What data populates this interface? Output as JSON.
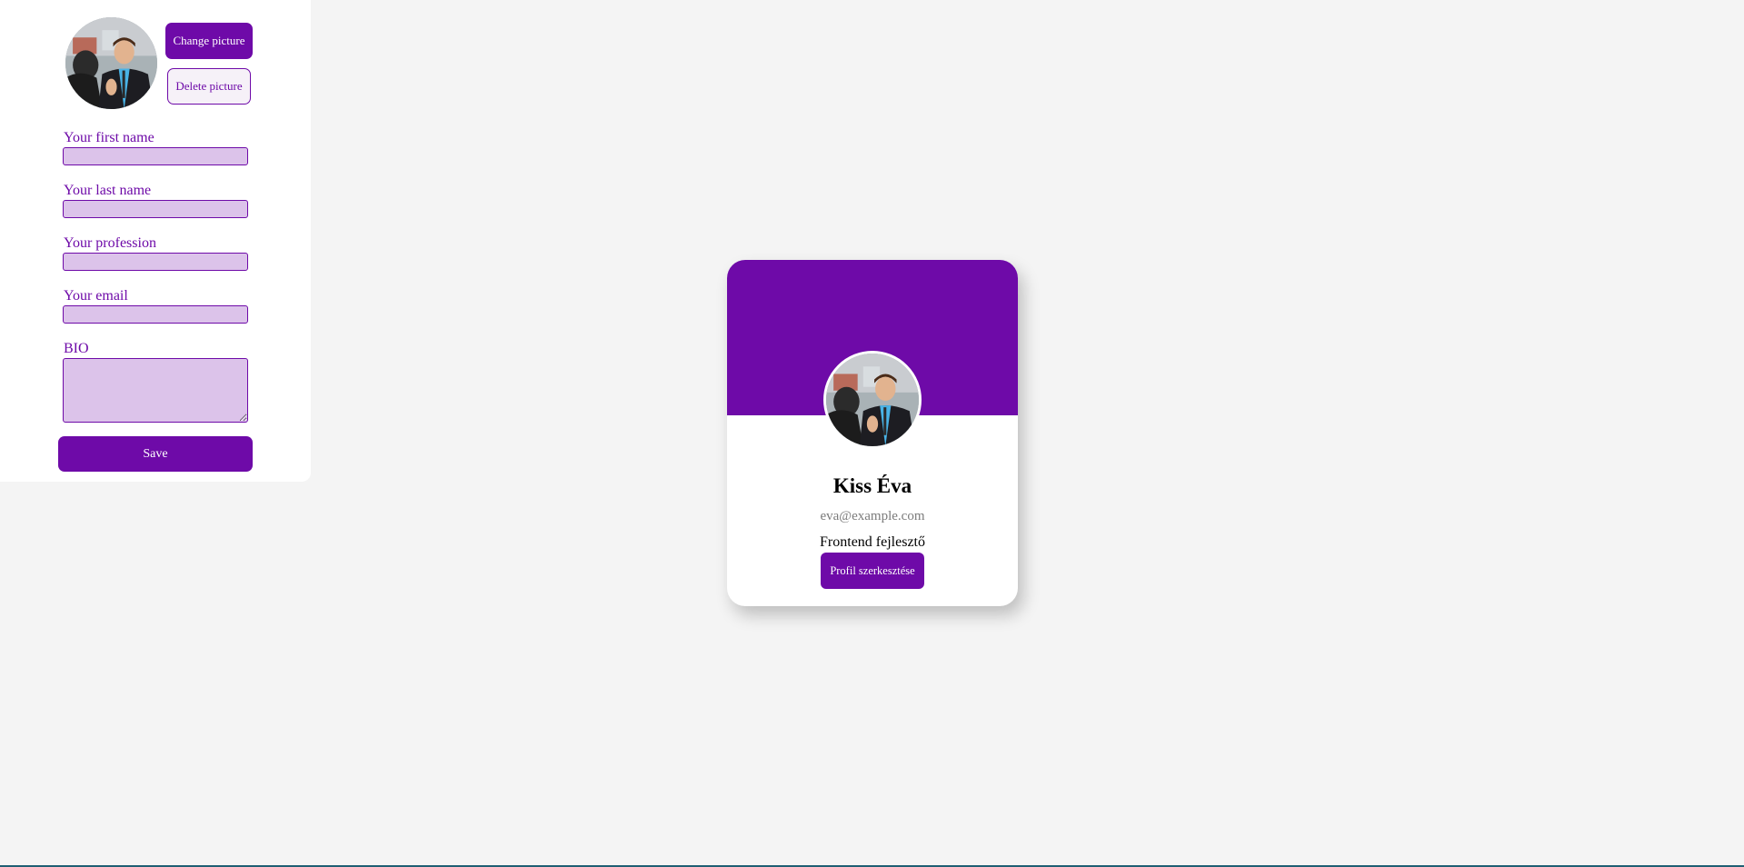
{
  "editor": {
    "change_picture_label": "Change picture",
    "delete_picture_label": "Delete picture",
    "fields": {
      "first_name": {
        "label": "Your first name",
        "value": ""
      },
      "last_name": {
        "label": "Your last name",
        "value": ""
      },
      "profession": {
        "label": "Your profession",
        "value": ""
      },
      "email": {
        "label": "Your email",
        "value": ""
      },
      "bio": {
        "label": "BIO",
        "value": ""
      }
    },
    "save_label": "Save"
  },
  "card": {
    "name": "Kiss Éva",
    "email": "eva@example.com",
    "profession": "Frontend fejlesztő",
    "edit_label": "Profil szerkesztése"
  },
  "colors": {
    "accent": "#6e0aa8",
    "input_fill": "#dcc3ea",
    "background": "#f4f4f4",
    "email_text": "#7b7b7b"
  },
  "icons": {
    "profile_photo": "avatar-photo"
  }
}
